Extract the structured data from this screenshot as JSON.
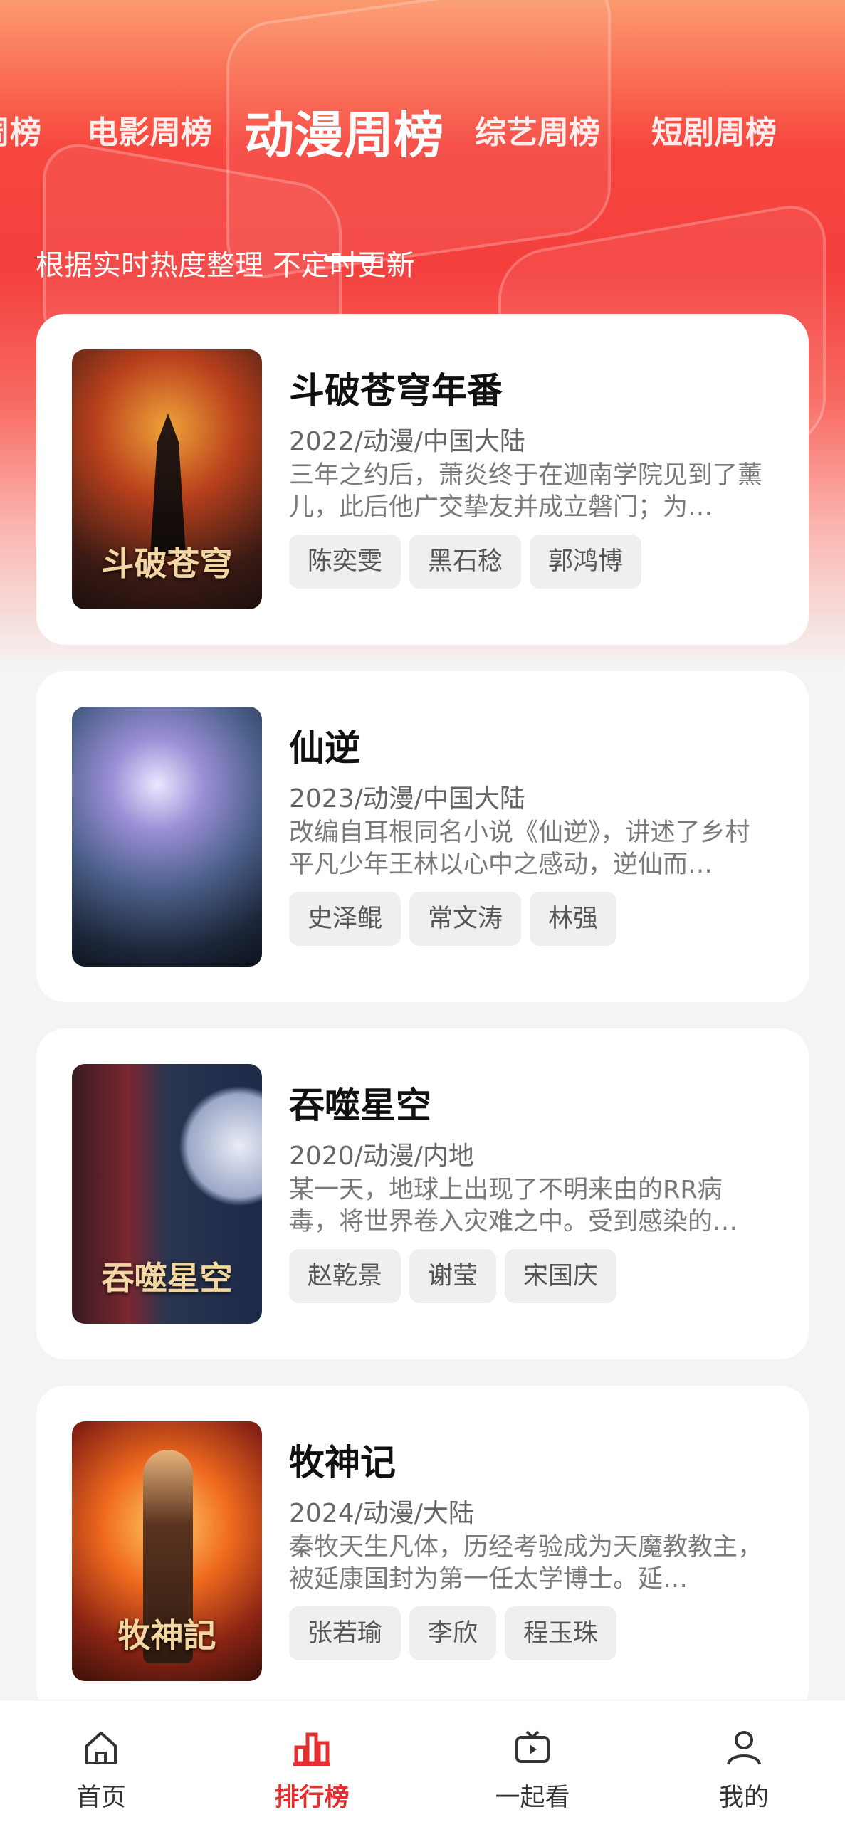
{
  "tabs": [
    "周榜",
    "电影周榜",
    "动漫周榜",
    "综艺周榜",
    "短剧周榜"
  ],
  "active_tab": "动漫周榜",
  "subtitle": "根据实时热度整理 不定时更新",
  "items": [
    {
      "title": "斗破苍穹年番",
      "meta": "2022/动漫/中国大陆",
      "desc": "三年之约后，萧炎终于在迦南学院见到了薰儿，此后他广交挚友并成立磐门；为…",
      "cast": [
        "陈奕雯",
        "黑石稔",
        "郭鸿博"
      ],
      "poster_text": "斗破苍穹"
    },
    {
      "title": "仙逆",
      "meta": "2023/动漫/中国大陆",
      "desc": "改编自耳根同名小说《仙逆》，讲述了乡村平凡少年王林以心中之感动，逆仙而…",
      "cast": [
        "史泽鲲",
        "常文涛",
        "林强"
      ],
      "poster_text": ""
    },
    {
      "title": "吞噬星空",
      "meta": "2020/动漫/内地",
      "desc": "某一天，地球上出现了不明来由的RR病毒，将世界卷入灾难之中。受到感染的…",
      "cast": [
        "赵乾景",
        "谢莹",
        "宋国庆"
      ],
      "poster_text": "吞噬星空"
    },
    {
      "title": "牧神记",
      "meta": "2024/动漫/大陆",
      "desc": "秦牧天生凡体，历经考验成为天魔教教主，被延康国封为第一任太学博士。延…",
      "cast": [
        "张若瑜",
        "李欣",
        "程玉珠"
      ],
      "poster_text": "牧神記"
    }
  ],
  "nav": [
    {
      "label": "首页",
      "icon": "home-icon"
    },
    {
      "label": "排行榜",
      "icon": "chart-icon"
    },
    {
      "label": "一起看",
      "icon": "tv-icon"
    },
    {
      "label": "我的",
      "icon": "user-icon"
    }
  ],
  "colors": {
    "accent": "#e52e2e",
    "header_red": "#f43f3d"
  }
}
